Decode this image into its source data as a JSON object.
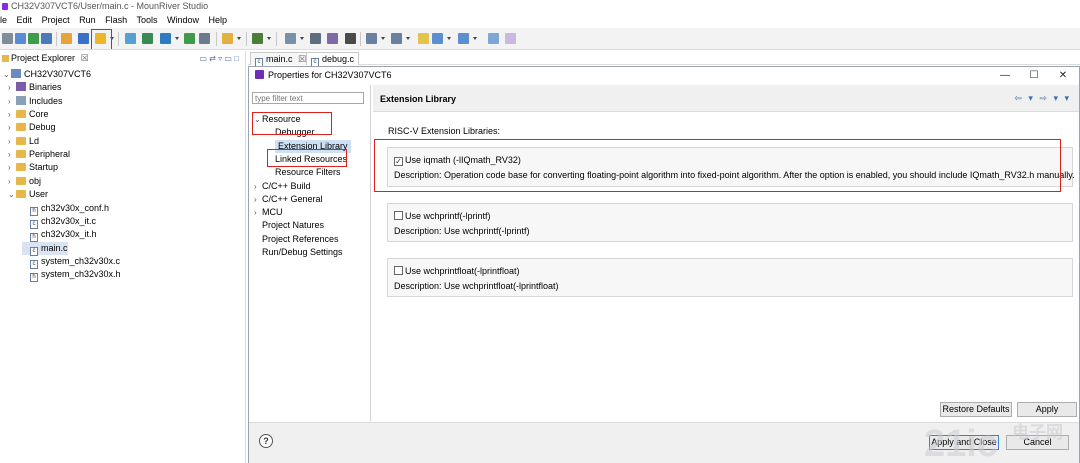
{
  "window": {
    "title": "CH32V307VCT6/User/main.c - MounRiver Studio"
  },
  "menu": [
    "le",
    "Edit",
    "Project",
    "Run",
    "Flash",
    "Tools",
    "Window",
    "Help"
  ],
  "explorer": {
    "title": "Project Explorer",
    "close_glyph": "☒",
    "tree": [
      {
        "label": "CH32V307VCT6",
        "level": 0,
        "kind": "project",
        "twisty": "⌄"
      },
      {
        "label": "Binaries",
        "level": 1,
        "kind": "binaries",
        "twisty": "›"
      },
      {
        "label": "Includes",
        "level": 1,
        "kind": "includes",
        "twisty": "›"
      },
      {
        "label": "Core",
        "level": 1,
        "kind": "folder",
        "twisty": "›"
      },
      {
        "label": "Debug",
        "level": 1,
        "kind": "folder",
        "twisty": "›"
      },
      {
        "label": "Ld",
        "level": 1,
        "kind": "folder",
        "twisty": "›"
      },
      {
        "label": "Peripheral",
        "level": 1,
        "kind": "folder",
        "twisty": "›"
      },
      {
        "label": "Startup",
        "level": 1,
        "kind": "folder",
        "twisty": "›"
      },
      {
        "label": "obj",
        "level": 1,
        "kind": "folder",
        "twisty": "›"
      },
      {
        "label": "User",
        "level": 1,
        "kind": "folder",
        "twisty": "⌄"
      },
      {
        "label": "ch32v30x_conf.h",
        "level": 2,
        "kind": "h",
        "twisty": ""
      },
      {
        "label": "ch32v30x_it.c",
        "level": 2,
        "kind": "c",
        "twisty": ""
      },
      {
        "label": "ch32v30x_it.h",
        "level": 2,
        "kind": "h",
        "twisty": ""
      },
      {
        "label": "main.c",
        "level": 2,
        "kind": "c",
        "twisty": "",
        "selected": true
      },
      {
        "label": "system_ch32v30x.c",
        "level": 2,
        "kind": "c",
        "twisty": ""
      },
      {
        "label": "system_ch32v30x.h",
        "level": 2,
        "kind": "h",
        "twisty": ""
      }
    ]
  },
  "editor_tabs": [
    {
      "label": "main.c",
      "close": "☒"
    },
    {
      "label": "debug.c",
      "close": ""
    }
  ],
  "dialog": {
    "title": "Properties for CH32V307VCT6",
    "minimize": "—",
    "maximize": "☐",
    "close": "✕",
    "filter_placeholder": "type filter text",
    "nav": [
      {
        "label": "Resource",
        "level": 0,
        "twisty": "⌄"
      },
      {
        "label": "Debugger",
        "level": 1,
        "twisty": ""
      },
      {
        "label": "Extension Library",
        "level": 1,
        "twisty": "",
        "selected": true
      },
      {
        "label": "Linked Resources",
        "level": 1,
        "twisty": ""
      },
      {
        "label": "Resource Filters",
        "level": 1,
        "twisty": ""
      },
      {
        "label": "C/C++ Build",
        "level": 0,
        "twisty": "›"
      },
      {
        "label": "C/C++ General",
        "level": 0,
        "twisty": "›"
      },
      {
        "label": "MCU",
        "level": 0,
        "twisty": "›"
      },
      {
        "label": "Project Natures",
        "level": 0,
        "twisty": ""
      },
      {
        "label": "Project References",
        "level": 0,
        "twisty": ""
      },
      {
        "label": "Run/Debug Settings",
        "level": 0,
        "twisty": ""
      }
    ],
    "page_title": "Extension Library",
    "header_nav": "⇦ ▾ ⇨ ▾ ▾",
    "section_title": "RISC-V Extension Libraries:",
    "extensions": [
      {
        "label": "Use iqmath (-lIQmath_RV32)",
        "checked": true,
        "description": "Description: Operation code base for converting floating-point algorithm into fixed-point algorithm. After the option is enabled, you should include IQmath_RV32.h manually."
      },
      {
        "label": "Use wchprintf(-lprintf)",
        "checked": false,
        "description": "Description: Use wchprintf(-lprintf)"
      },
      {
        "label": "Use wchprintfloat(-lprintfloat)",
        "checked": false,
        "description": "Description: Use wchprintfloat(-lprintfloat)"
      }
    ],
    "buttons": {
      "restore_defaults": "Restore Defaults",
      "apply": "Apply",
      "apply_and_close": "Apply and Close",
      "cancel": "Cancel",
      "help": "?"
    }
  },
  "watermark": {
    "text": "电子网",
    "logo_digits": "21ic"
  },
  "colors": {
    "annotation_red": "#e0201b",
    "selection_blue": "#cde0f5",
    "toolbar_bg": "#f3f3f3"
  }
}
